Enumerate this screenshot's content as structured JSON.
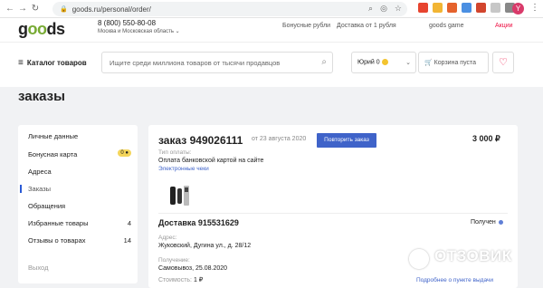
{
  "browser": {
    "url": "goods.ru/personal/order/",
    "profile": "Y"
  },
  "header": {
    "logo_a": "g",
    "logo_b": "oo",
    "logo_c": "ds",
    "phone": "8 (800) 550-80-08",
    "region": "Москва и Московская область",
    "links": [
      "Бонусные рубли",
      "Доставка от 1 рубля",
      "goods game",
      "Акции"
    ]
  },
  "toolbar": {
    "catalog": "Каталог товаров",
    "search_placeholder": "Ищите среди миллиона товаров от тысячи продавцов",
    "user": "Юрий 0",
    "cart": "Корзина пуста"
  },
  "page": {
    "title": "заказы"
  },
  "sidebar": {
    "items": [
      {
        "label": "Личные данные"
      },
      {
        "label": "Бонусная карта",
        "badge": "0"
      },
      {
        "label": "Адреса"
      },
      {
        "label": "Заказы"
      },
      {
        "label": "Обращения"
      },
      {
        "label": "Избранные товары",
        "count": "4"
      },
      {
        "label": "Отзывы о товарах",
        "count": "14"
      },
      {
        "label": "Выход"
      }
    ]
  },
  "order": {
    "number": "заказ 949026111",
    "date": "от 23 августа 2020",
    "repeat": "Повторить заказ",
    "sum": "3 000 ₽",
    "pay_type_label": "Тип оплаты:",
    "pay_type": "Оплата банковской картой на сайте",
    "checks": "Электронные чеки",
    "delivery": "Доставка 915531629",
    "status": "Получен",
    "address_label": "Адрес:",
    "address": "Жуковский, Дугина ул., д. 28/12",
    "received_label": "Получение:",
    "received": "Самовывоз, 25.08.2020",
    "cost_label": "Стоимость:",
    "cost": "1 ₽",
    "details": "Подробнее о пункте выдачи"
  },
  "watermark": "ОТЗОВИК"
}
